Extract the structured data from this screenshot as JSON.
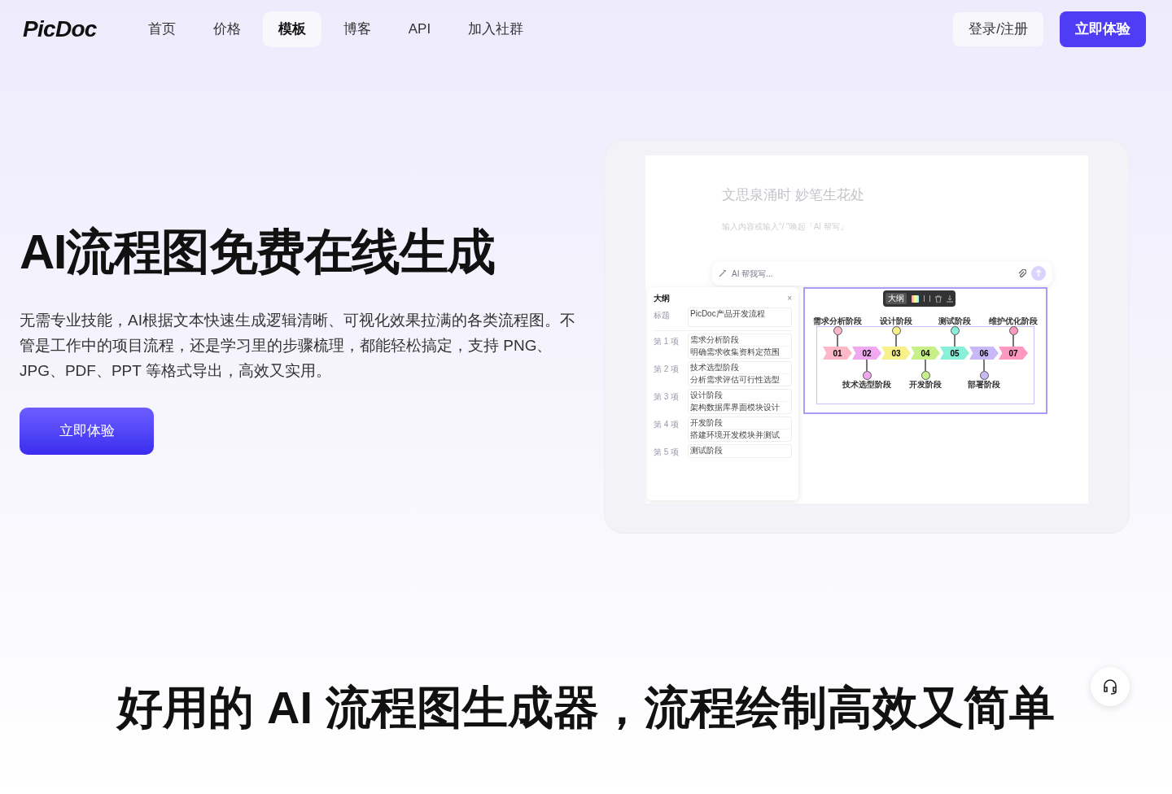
{
  "nav": {
    "logo": "PicDoc",
    "links": [
      {
        "label": "首页",
        "selected": false
      },
      {
        "label": "价格",
        "selected": false
      },
      {
        "label": "模板",
        "selected": true
      },
      {
        "label": "博客",
        "selected": false
      },
      {
        "label": "API",
        "selected": false
      },
      {
        "label": "加入社群",
        "selected": false
      }
    ],
    "login": "登录/注册",
    "cta": "立即体验"
  },
  "hero": {
    "title": "AI流程图免费在线生成",
    "paragraph": "无需专业技能，AI根据文本快速生成逻辑清晰、可视化效果拉满的各类流程图。不管是工作中的项目流程，还是学习里的步骤梳理，都能轻松搞定，支持 PNG、JPG、PDF、PPT 等格式导出，高效又实用。",
    "button": "立即体验"
  },
  "preview": {
    "doc_title": "文思泉涌时 妙笔生花处",
    "doc_hint": "输入内容或输入\"/ \"唤起「AI 帮写」",
    "ai_placeholder": "AI 帮我写...",
    "outline": {
      "heading": "大纲",
      "close_glyph": "×",
      "title_label": "标题",
      "title_value": "PicDoc产品开发流程",
      "items": [
        {
          "label": "第 1 项",
          "title": "需求分析阶段",
          "desc": "明确需求收集资料定范围"
        },
        {
          "label": "第 2 项",
          "title": "技术选型阶段",
          "desc": "分析需求评估可行性选型"
        },
        {
          "label": "第 3 项",
          "title": "设计阶段",
          "desc": "架构数据库界面模块设计"
        },
        {
          "label": "第 4 项",
          "title": "开发阶段",
          "desc": "搭建环境开发模块并测试"
        },
        {
          "label": "第 5 项",
          "title": "测试阶段"
        }
      ]
    },
    "toolbar_label": "大纲",
    "steps": [
      {
        "number": "01",
        "title": "需求分析阶段",
        "color": "#ffb8c8",
        "above": true
      },
      {
        "number": "02",
        "title": "技术选型阶段",
        "color": "#f0a8f0",
        "above": false
      },
      {
        "number": "03",
        "title": "设计阶段",
        "color": "#f8f088",
        "above": true
      },
      {
        "number": "04",
        "title": "开发阶段",
        "color": "#c8f088",
        "above": false
      },
      {
        "number": "05",
        "title": "测试阶段",
        "color": "#88f0d8",
        "above": true
      },
      {
        "number": "06",
        "title": "部署阶段",
        "color": "#c8b8f8",
        "above": false
      },
      {
        "number": "07",
        "title": "维护优化阶段",
        "color": "#ff98c0",
        "above": true
      }
    ]
  },
  "section_title": "好用的 AI 流程图生成器，流程绘制高效又简单"
}
